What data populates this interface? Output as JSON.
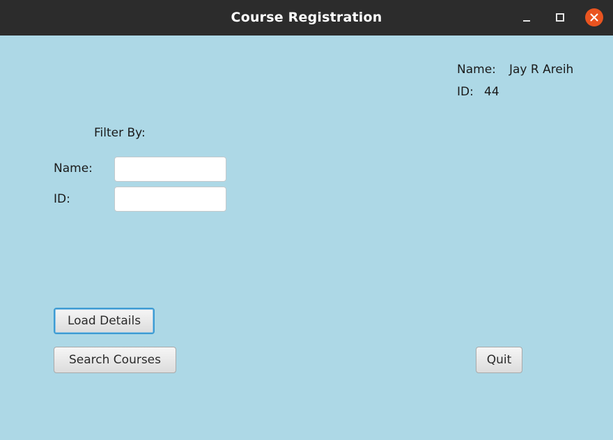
{
  "window": {
    "title": "Course Registration"
  },
  "user_info": {
    "name_label": "Name:",
    "name_value": "Jay R Areih",
    "id_label": "ID:",
    "id_value": "44"
  },
  "filter": {
    "heading": "Filter By:",
    "name_label": "Name:",
    "name_value": "",
    "id_label": "ID:",
    "id_value": ""
  },
  "buttons": {
    "load_details": "Load Details",
    "search_courses": "Search Courses",
    "quit": "Quit"
  },
  "colors": {
    "background": "#add8e6",
    "titlebar": "#2c2c2c",
    "close_button": "#e95420",
    "focus_ring": "#3d9bd3"
  }
}
